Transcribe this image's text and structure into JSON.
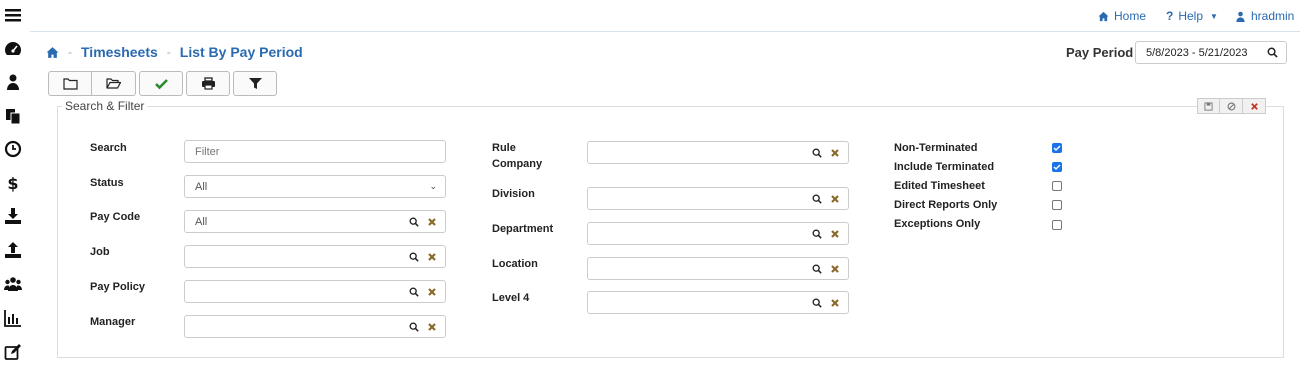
{
  "sidebar": {
    "items": [
      {
        "icon": "menu-icon"
      },
      {
        "icon": "dashboard-icon"
      },
      {
        "icon": "user-icon"
      },
      {
        "icon": "documents-icon"
      },
      {
        "icon": "clock-icon"
      },
      {
        "icon": "dollar-icon"
      },
      {
        "icon": "download-icon"
      },
      {
        "icon": "upload-icon"
      },
      {
        "icon": "users-icon"
      },
      {
        "icon": "chart-icon"
      },
      {
        "icon": "edit-icon"
      }
    ]
  },
  "topbar": {
    "home": "Home",
    "help": "Help",
    "user": "hradmin"
  },
  "breadcrumb": {
    "section": "Timesheets",
    "page": "List By Pay Period"
  },
  "pay_period": {
    "label": "Pay Period",
    "value": "5/8/2023 - 5/21/2023"
  },
  "toolbar": {
    "buttons": [
      "new-folder-icon",
      "open-folder-icon",
      "checkmark-icon",
      "print-icon",
      "filter-icon"
    ]
  },
  "panel": {
    "legend": "Search & Filter"
  },
  "filters": {
    "search": {
      "label": "Search",
      "placeholder": "Filter",
      "value": ""
    },
    "status": {
      "label": "Status",
      "value": "All"
    },
    "pay_code": {
      "label": "Pay Code",
      "value": "All"
    },
    "job": {
      "label": "Job",
      "value": ""
    },
    "pay_policy": {
      "label": "Pay Policy",
      "value": ""
    },
    "manager": {
      "label": "Manager",
      "value": ""
    },
    "rule_company": {
      "label_line1": "Rule",
      "label_line2": "Company",
      "value": ""
    },
    "division": {
      "label": "Division",
      "value": ""
    },
    "department": {
      "label": "Department",
      "value": ""
    },
    "location": {
      "label": "Location",
      "value": ""
    },
    "level4": {
      "label": "Level 4",
      "value": ""
    }
  },
  "options": [
    {
      "label": "Non-Terminated",
      "checked": true
    },
    {
      "label": "Include Terminated",
      "checked": true
    },
    {
      "label": "Edited Timesheet",
      "checked": false
    },
    {
      "label": "Direct Reports Only",
      "checked": false
    },
    {
      "label": "Exceptions Only",
      "checked": false
    }
  ],
  "colors": {
    "link": "#2a6ab0",
    "check": "#1a73e8",
    "clear": "#8a6a2a",
    "approve": "#2e8b2e",
    "close": "#c0392b"
  }
}
